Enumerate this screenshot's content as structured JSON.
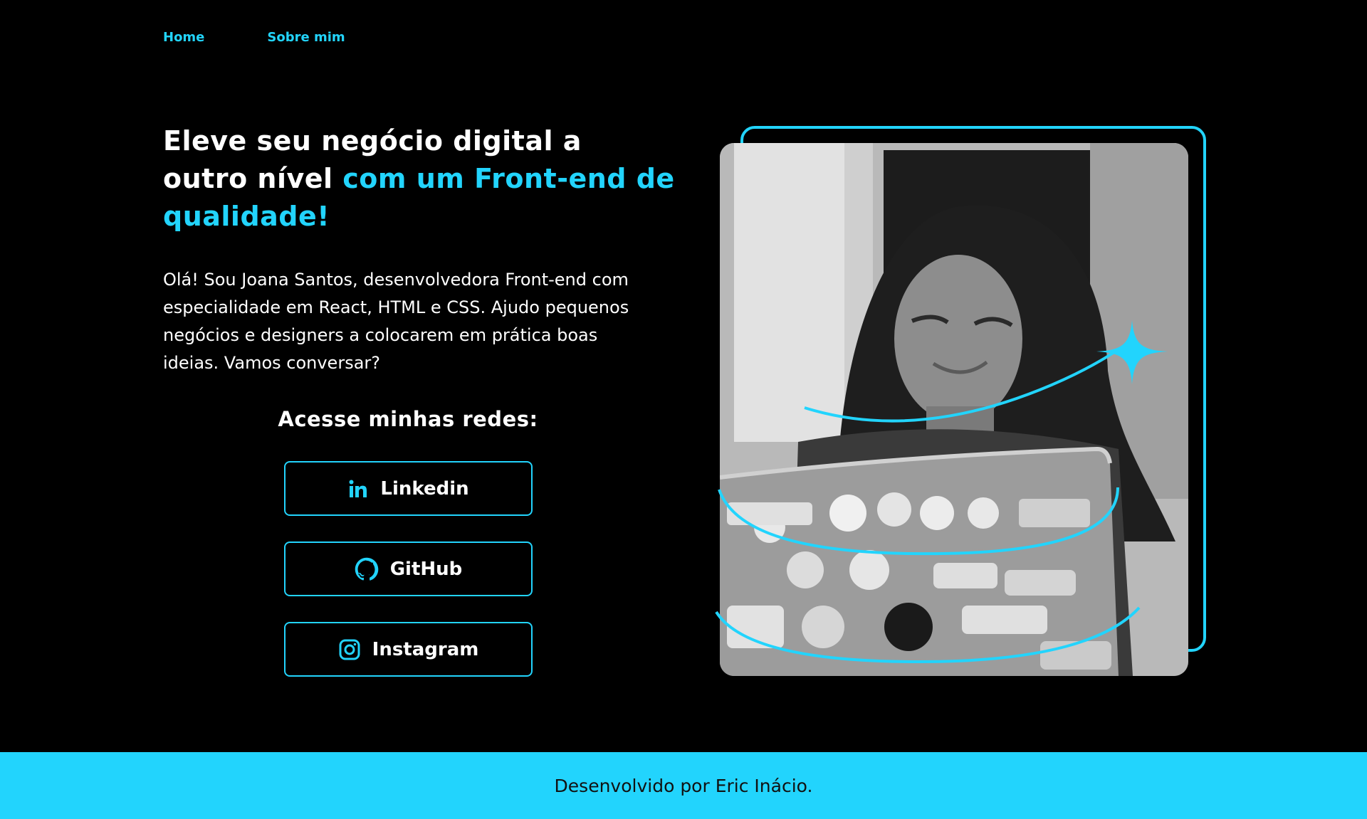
{
  "nav": {
    "items": [
      {
        "label": "Home"
      },
      {
        "label": "Sobre mim"
      }
    ]
  },
  "hero": {
    "title_part1": "Eleve seu negócio digital a outro nível",
    "title_part2": "com um Front-end de qualidade!",
    "intro": "Olá! Sou Joana Santos, desenvolvedora Front-end com especialidade em React, HTML e CSS. Ajudo pequenos negócios e designers a colocarem em prática boas ideias. Vamos conversar?"
  },
  "networks": {
    "title": "Acesse minhas redes:",
    "buttons": [
      {
        "label": "Linkedin",
        "icon": "linkedin-icon"
      },
      {
        "label": "GitHub",
        "icon": "github-icon"
      },
      {
        "label": "Instagram",
        "icon": "instagram-icon"
      }
    ]
  },
  "footer": {
    "text": "Desenvolvido por Eric Inácio."
  },
  "colors": {
    "background": "#000000",
    "accent": "#22d4fd",
    "text": "#ffffff",
    "footer_text": "#111111"
  }
}
